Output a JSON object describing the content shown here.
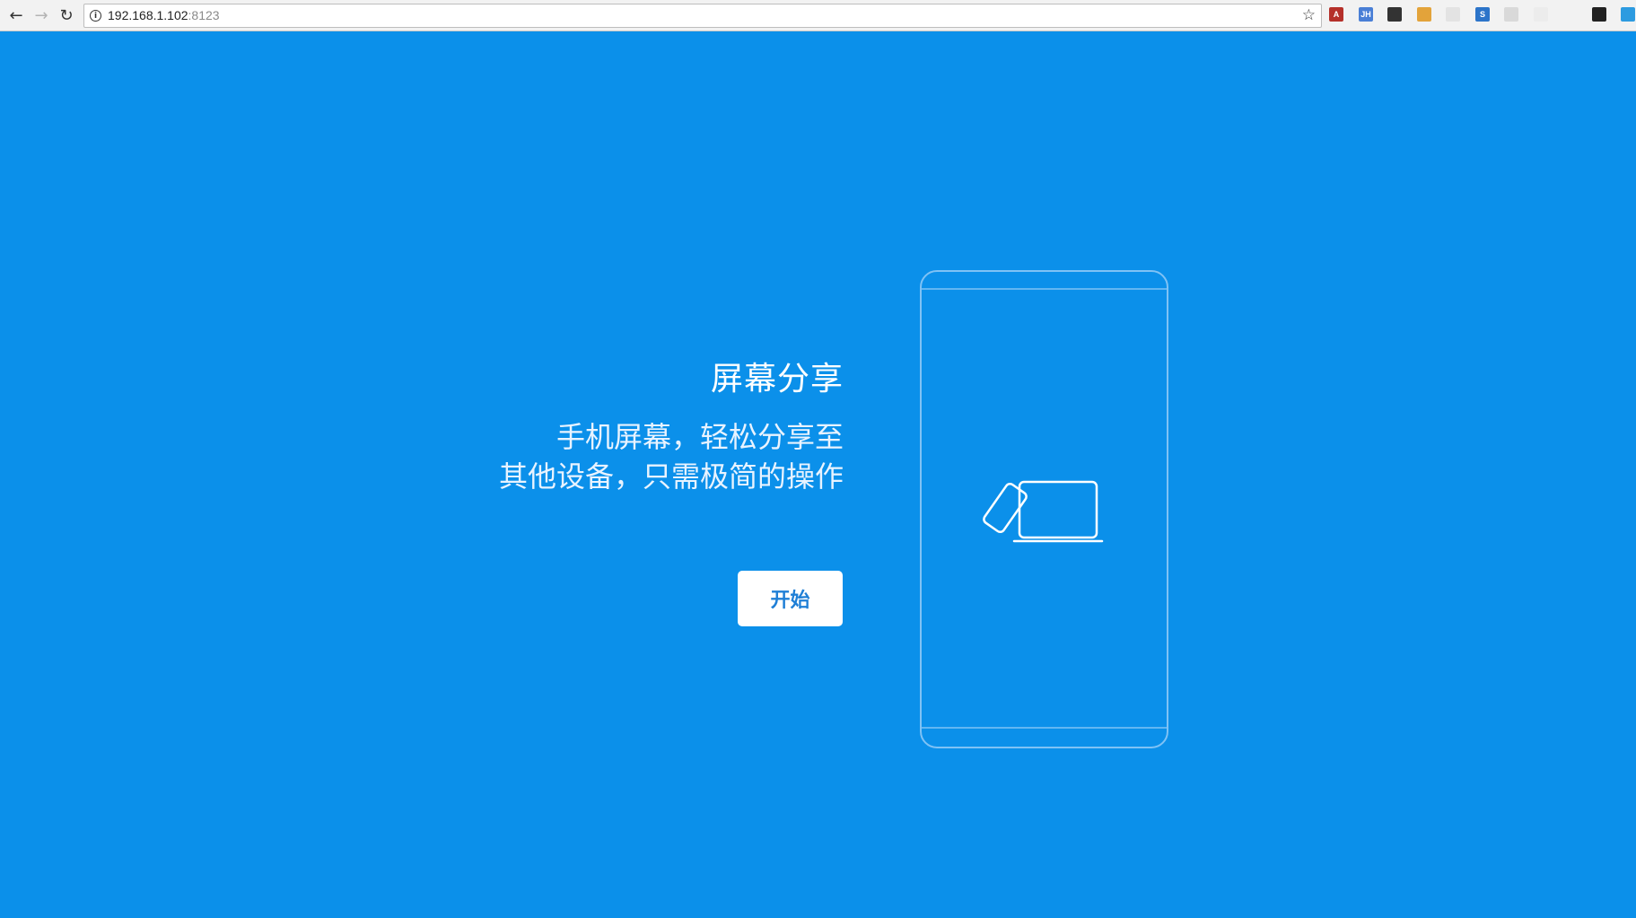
{
  "browser": {
    "url_host": "192.168.1.102",
    "url_port": ":8123",
    "extensions": [
      {
        "name": "acrobat-extension-icon",
        "glyph": "A",
        "bg": "#b5302a"
      },
      {
        "name": "jh-extension-icon",
        "glyph": "JH",
        "bg": "#4a7fd6"
      },
      {
        "name": "incognito-extension-icon",
        "glyph": "",
        "bg": "#333333"
      },
      {
        "name": "shopping-extension-icon",
        "glyph": "",
        "bg": "#e3a33a"
      },
      {
        "name": "user-extension-icon",
        "glyph": "",
        "bg": "#e3e3e3"
      },
      {
        "name": "s-extension-icon",
        "glyph": "S",
        "bg": "#2c74c9"
      },
      {
        "name": "shield-extension-icon",
        "glyph": "",
        "bg": "#d9d9d9"
      },
      {
        "name": "graph-extension-icon",
        "glyph": "",
        "bg": "#ececec"
      },
      {
        "name": "sync-extension-icon",
        "glyph": "",
        "bg": "#f2f2f2"
      },
      {
        "name": "cloud-extension-icon",
        "glyph": "",
        "bg": "#222222"
      },
      {
        "name": "page-extension-icon",
        "glyph": "",
        "bg": "#2d9be0"
      }
    ]
  },
  "main": {
    "title": "屏幕分享",
    "subtitle_line1": "手机屏幕，轻松分享至",
    "subtitle_line2": "其他设备，只需极简的操作",
    "start_button": "开始"
  },
  "colors": {
    "background": "#0b90ea",
    "button_text": "#1f7fd6"
  }
}
